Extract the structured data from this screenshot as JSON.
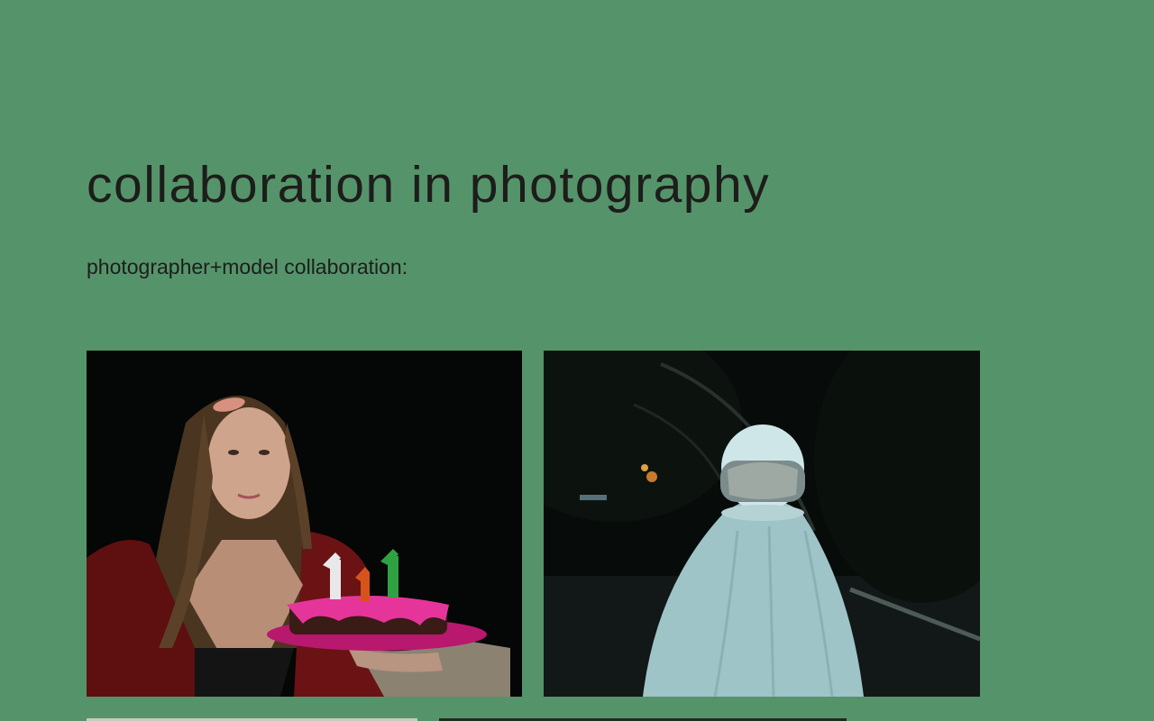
{
  "page": {
    "title": "collaboration in photography",
    "subtitle": "photographer+model collaboration:"
  },
  "gallery": {
    "photos": [
      {
        "subject": "girl holding birthday cake with 1 1 1 candles"
      },
      {
        "subject": "figure in white sheet wearing astronaut helmet at night"
      },
      {
        "subject": "third photo (cropped at bottom edge)"
      },
      {
        "subject": "fourth photo (cropped at bottom edge)"
      }
    ]
  },
  "colors": {
    "background": "#55946a",
    "text": "#1d1d1b"
  }
}
